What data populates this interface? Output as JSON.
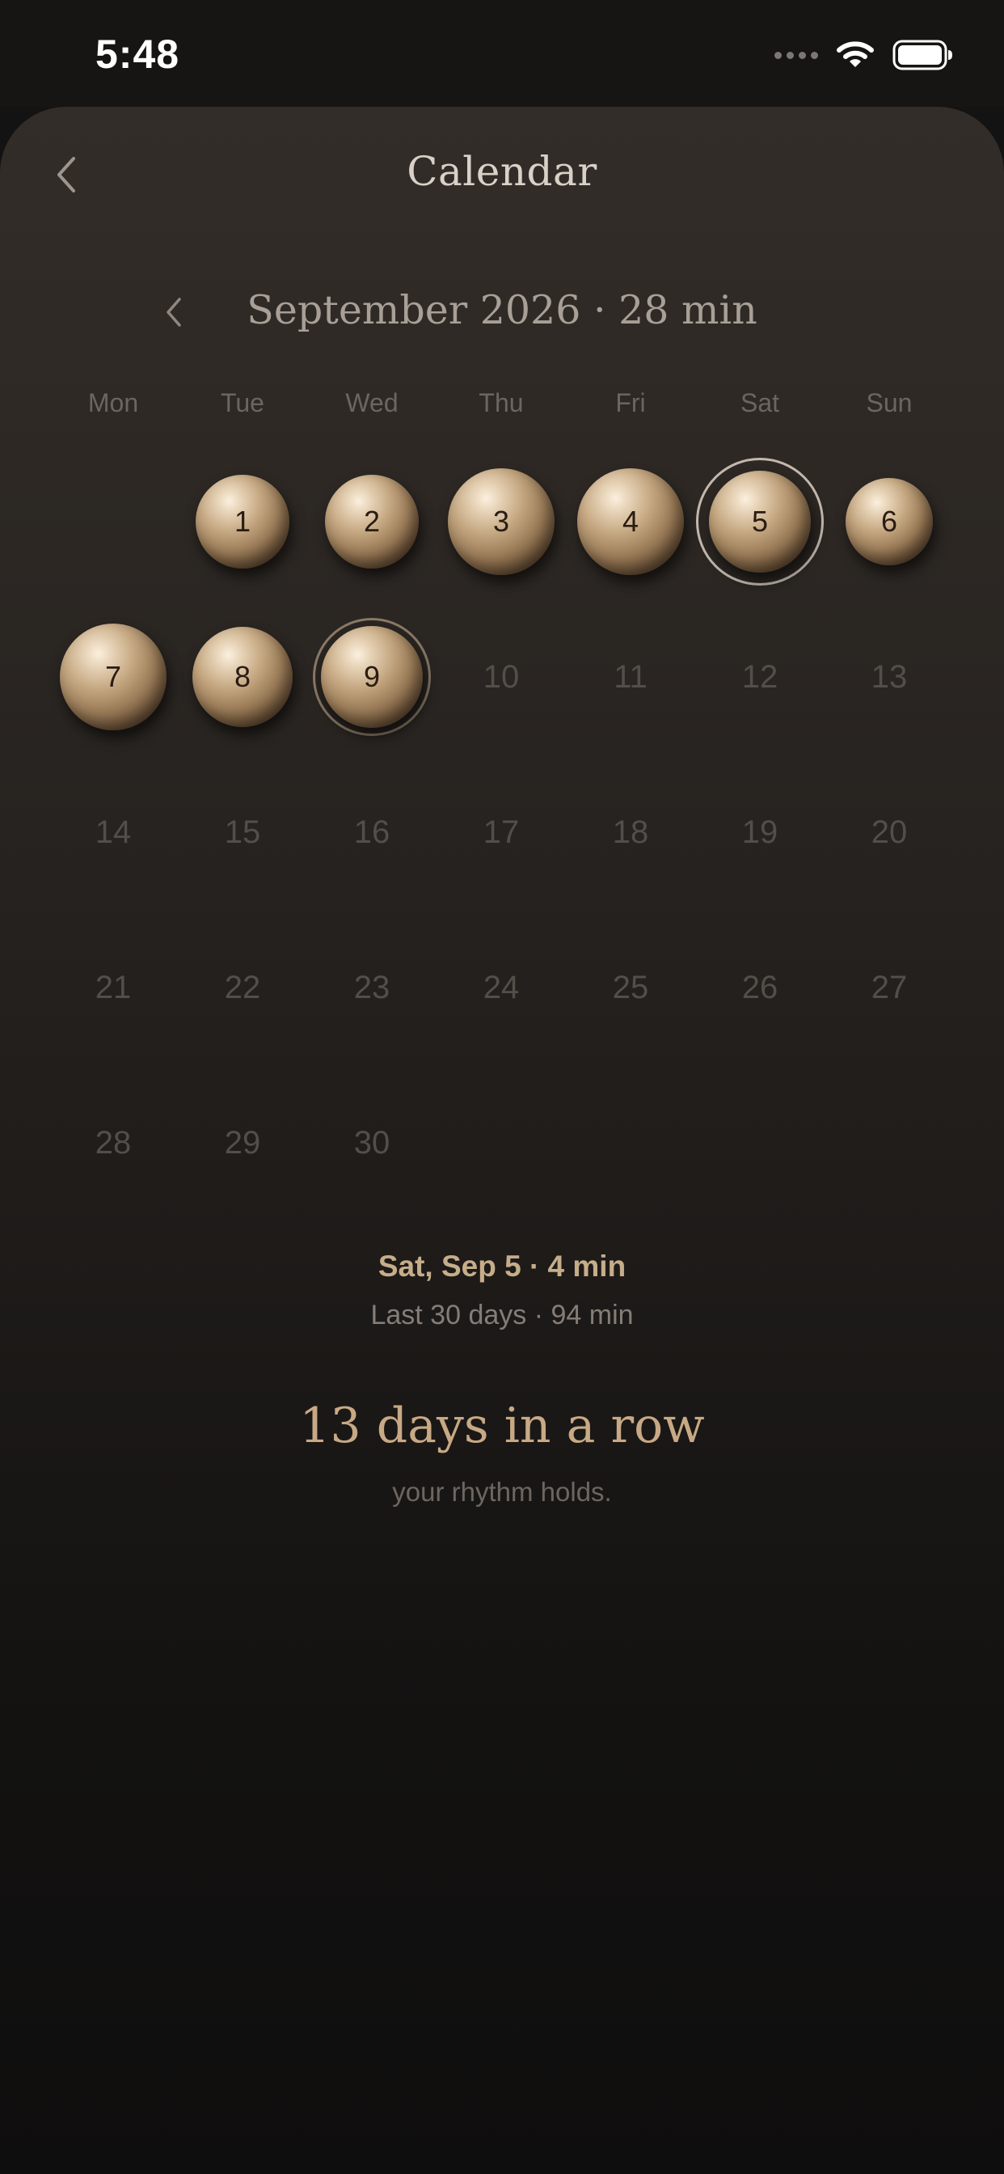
{
  "status_bar": {
    "time": "5:48",
    "signal_icon": "signal-dots-icon",
    "wifi_icon": "wifi-icon",
    "battery_icon": "battery-icon"
  },
  "header": {
    "title": "Calendar",
    "back_icon": "chevron-left-icon"
  },
  "month": {
    "title": "September 2026 · 28 min",
    "prev_icon": "chevron-left-icon"
  },
  "weekdays": [
    "Mon",
    "Tue",
    "Wed",
    "Thu",
    "Fri",
    "Sat",
    "Sun"
  ],
  "days": [
    {
      "label": "1",
      "col": 1,
      "row": 0,
      "practiced": true
    },
    {
      "label": "2",
      "col": 2,
      "row": 0,
      "practiced": true
    },
    {
      "label": "3",
      "col": 3,
      "row": 0,
      "practiced": true
    },
    {
      "label": "4",
      "col": 4,
      "row": 0,
      "practiced": true
    },
    {
      "label": "5",
      "col": 5,
      "row": 0,
      "practiced": true,
      "selected": true
    },
    {
      "label": "6",
      "col": 6,
      "row": 0,
      "practiced": true
    },
    {
      "label": "7",
      "col": 0,
      "row": 1,
      "practiced": true
    },
    {
      "label": "8",
      "col": 1,
      "row": 1,
      "practiced": true
    },
    {
      "label": "9",
      "col": 2,
      "row": 1,
      "practiced": true,
      "today": true
    },
    {
      "label": "10",
      "col": 3,
      "row": 1
    },
    {
      "label": "11",
      "col": 4,
      "row": 1
    },
    {
      "label": "12",
      "col": 5,
      "row": 1
    },
    {
      "label": "13",
      "col": 6,
      "row": 1
    },
    {
      "label": "14",
      "col": 0,
      "row": 2
    },
    {
      "label": "15",
      "col": 1,
      "row": 2
    },
    {
      "label": "16",
      "col": 2,
      "row": 2
    },
    {
      "label": "17",
      "col": 3,
      "row": 2
    },
    {
      "label": "18",
      "col": 4,
      "row": 2
    },
    {
      "label": "19",
      "col": 5,
      "row": 2
    },
    {
      "label": "20",
      "col": 6,
      "row": 2
    },
    {
      "label": "21",
      "col": 0,
      "row": 3
    },
    {
      "label": "22",
      "col": 1,
      "row": 3
    },
    {
      "label": "23",
      "col": 2,
      "row": 3
    },
    {
      "label": "24",
      "col": 3,
      "row": 3
    },
    {
      "label": "25",
      "col": 4,
      "row": 3
    },
    {
      "label": "26",
      "col": 5,
      "row": 3
    },
    {
      "label": "27",
      "col": 6,
      "row": 3
    },
    {
      "label": "28",
      "col": 0,
      "row": 4
    },
    {
      "label": "29",
      "col": 1,
      "row": 4
    },
    {
      "label": "30",
      "col": 2,
      "row": 4
    }
  ],
  "summary": {
    "selected_day": "Sat, Sep 5 · 4 min",
    "last_30_days": "Last 30 days · 94 min"
  },
  "streak": {
    "title": "13 days in a row",
    "subtitle": "your rhythm holds."
  },
  "colors": {
    "accent_gold": "#c8a985",
    "orb_highlight": "#fbf0de",
    "orb_shadow": "#2a1e14",
    "ring": "#c2b8ad",
    "inactive_day": "#544e49"
  }
}
